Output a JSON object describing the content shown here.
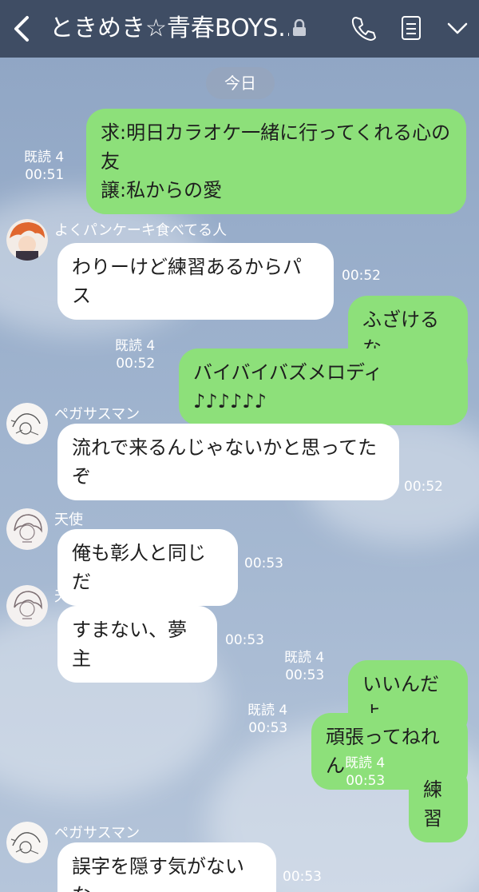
{
  "header": {
    "title": "ときめき☆青春BOYS...",
    "back_icon": "chevron-left-icon",
    "lock_icon": "lock-icon",
    "call_icon": "phone-icon",
    "notes_icon": "notes-icon",
    "menu_icon": "chevron-down-icon"
  },
  "date_label": "今日",
  "colors": {
    "header_bg": "#3f4d64",
    "bubble_out": "#8de07a",
    "bubble_in": "#ffffff",
    "chat_bg": "#9bb0cc"
  },
  "messages": [
    {
      "dir": "out",
      "lines": [
        "求:明日カラオケ一緒に行ってくれる心の",
        "友",
        "譲:私からの愛"
      ],
      "read": "既読 4",
      "time": "00:51"
    },
    {
      "dir": "in",
      "sender": "よくパンケーキ食べてる人",
      "avatar": "orange-hair-avatar",
      "lines": [
        "わりーけど練習あるからパス"
      ],
      "time": "00:52"
    },
    {
      "dir": "out",
      "lines": [
        "ふざけるな"
      ],
      "read": "既読 4",
      "time": "00:52"
    },
    {
      "dir": "out",
      "lines": [
        "バイバイバズメロディ♪♪♪♪♪♪"
      ],
      "read": "既読 4",
      "time": "00:52"
    },
    {
      "dir": "in",
      "sender": "ペガサスマン",
      "avatar": "sketch-avatar",
      "lines": [
        "流れで来るんじゃないかと思ってた",
        "ぞ"
      ],
      "time": "00:52"
    },
    {
      "dir": "in",
      "sender": "天使",
      "avatar": "angel-avatar",
      "lines": [
        "俺も彰人と同じだ"
      ],
      "time": "00:53"
    },
    {
      "dir": "in",
      "sender": "天使",
      "avatar": "angel-avatar",
      "lines": [
        "すまない、夢主"
      ],
      "time": "00:53"
    },
    {
      "dir": "out",
      "lines": [
        "いいんだよ"
      ],
      "read": "既読 4",
      "time": "00:53"
    },
    {
      "dir": "out",
      "lines": [
        "頑張ってねれん"
      ],
      "read": "既読 4",
      "time": "00:53"
    },
    {
      "dir": "out",
      "lines": [
        "練習"
      ],
      "read": "既読 4",
      "time": "00:53"
    },
    {
      "dir": "in",
      "sender": "ペガサスマン",
      "avatar": "sketch-avatar",
      "lines": [
        "誤字を隠す気がないな"
      ],
      "time": "00:53"
    }
  ]
}
